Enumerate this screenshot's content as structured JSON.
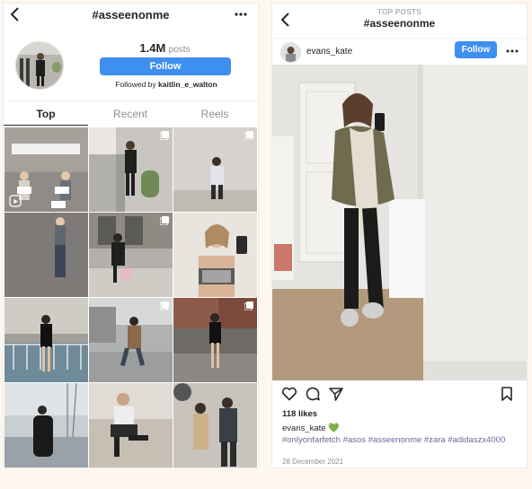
{
  "left_screen": {
    "header": {
      "title": "#asseenonme"
    },
    "profile": {
      "post_count": "1.4M",
      "post_label": "posts",
      "follow_label": "Follow",
      "followed_by_prefix": "Followed by",
      "followed_by_user": "kaitlin_e_walton"
    },
    "tabs": [
      "Top",
      "Recent",
      "Reels"
    ],
    "active_tab": "Top"
  },
  "right_screen": {
    "header": {
      "subtitle": "TOP POSTS",
      "title": "#asseenonme"
    },
    "post": {
      "username": "evans_kate",
      "follow_label": "Follow",
      "likes": "118 likes",
      "caption_user": "evans_kate",
      "caption_emoji": "💚",
      "hashtags": "#onlyonfarfetch #asos #asseenonme #zara #adidaszx4000",
      "date": "28 December 2021"
    }
  },
  "colors": {
    "follow_button": "#3d8ff0",
    "hashtag": "#6a6a9a",
    "muted_text": "#8e8e8e"
  },
  "icons": [
    "back-arrow-icon",
    "more-horizontal-icon",
    "heart-icon",
    "comment-icon",
    "share-icon",
    "bookmark-icon",
    "multiple-photos-icon",
    "reel-icon"
  ]
}
